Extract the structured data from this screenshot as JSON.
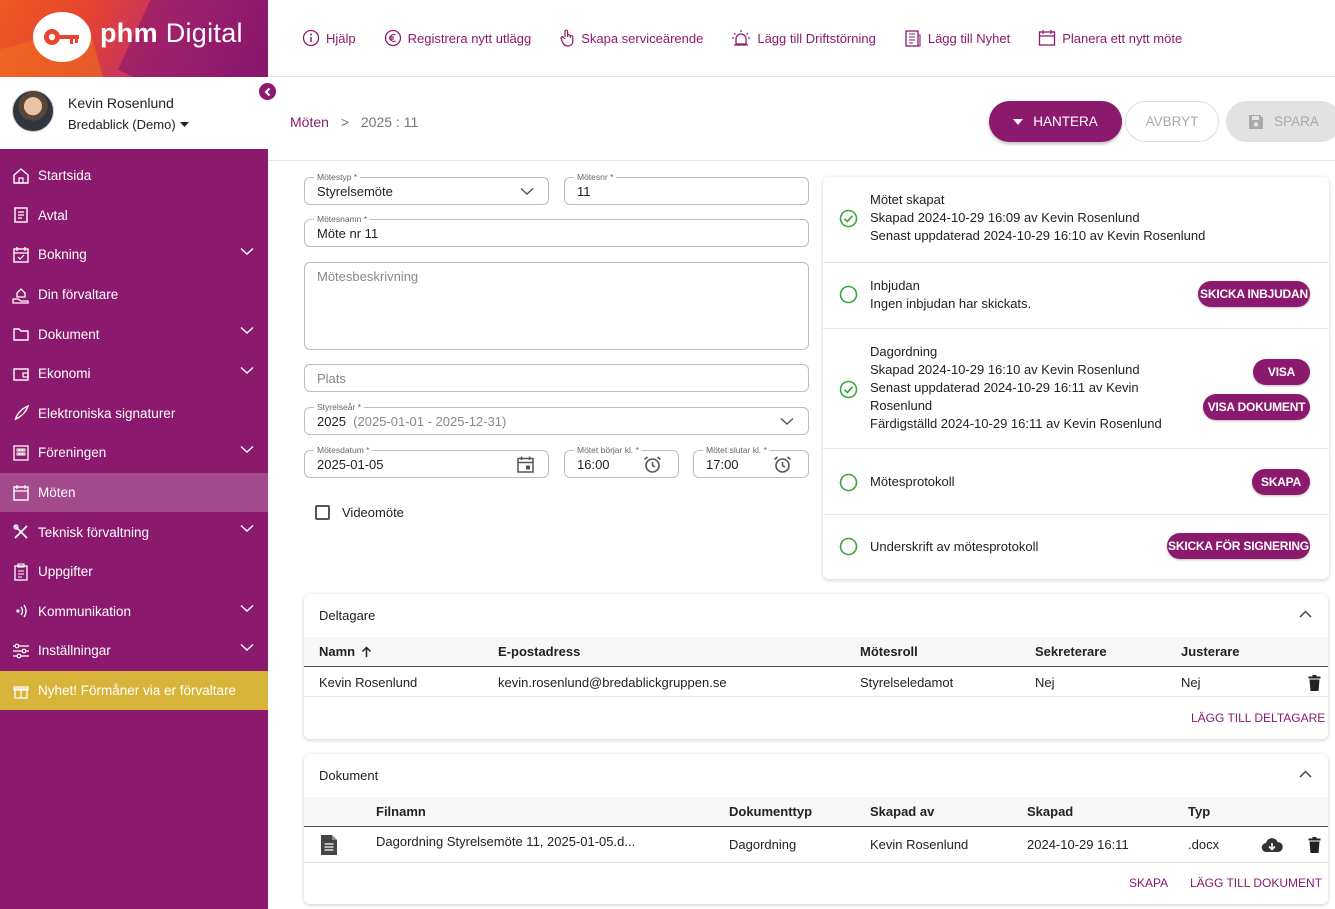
{
  "brand": {
    "name_bold": "phm",
    "name_rest": " Digital"
  },
  "user": {
    "name": "Kevin Rosenlund",
    "org": "Bredablick (Demo)"
  },
  "nav": [
    {
      "label": "Startsida",
      "icon": "home-icon",
      "chevron": false
    },
    {
      "label": "Avtal",
      "icon": "contract-icon",
      "chevron": false
    },
    {
      "label": "Bokning",
      "icon": "calendar-check-icon",
      "chevron": true
    },
    {
      "label": "Din förvaltare",
      "icon": "hand-house-icon",
      "chevron": false
    },
    {
      "label": "Dokument",
      "icon": "folder-icon",
      "chevron": true
    },
    {
      "label": "Ekonomi",
      "icon": "wallet-icon",
      "chevron": true
    },
    {
      "label": "Elektroniska signaturer",
      "icon": "feather-pen-icon",
      "chevron": false
    },
    {
      "label": "Föreningen",
      "icon": "building-icon",
      "chevron": true
    },
    {
      "label": "Möten",
      "icon": "calendar-icon",
      "chevron": false,
      "active": true
    },
    {
      "label": "Teknisk förvaltning",
      "icon": "tools-icon",
      "chevron": true
    },
    {
      "label": "Uppgifter",
      "icon": "checklist-icon",
      "chevron": false
    },
    {
      "label": "Kommunikation",
      "icon": "broadcast-icon",
      "chevron": true
    },
    {
      "label": "Inställningar",
      "icon": "sliders-icon",
      "chevron": true
    },
    {
      "label": "Nyhet! Förmåner via er förvaltare",
      "icon": "gift-icon",
      "chevron": false,
      "promo": true
    }
  ],
  "toolbar": {
    "help": "Hjälp",
    "expense": "Registrera nytt utlägg",
    "service": "Skapa serviceärende",
    "disruption": "Lägg till Driftstörning",
    "news": "Lägg till Nyhet",
    "meeting": "Planera ett nytt möte"
  },
  "breadcrumb": {
    "parent": "Möten",
    "separator": ">",
    "current": "2025 : 11"
  },
  "actions": {
    "manage": "HANTERA",
    "cancel": "AVBRYT",
    "save": "SPARA"
  },
  "form": {
    "meeting_type": {
      "label": "Mötestyp *",
      "value": "Styrelsemöte"
    },
    "meeting_no": {
      "label": "Mötesnr *",
      "value": "11"
    },
    "meeting_name": {
      "label": "Mötesnamn *",
      "value": "Möte nr 11"
    },
    "description": {
      "placeholder": "Mötesbeskrivning"
    },
    "location": {
      "placeholder": "Plats"
    },
    "board_year": {
      "label": "Styrelseår *",
      "value": "2025",
      "range": "(2025-01-01 - 2025-12-31)"
    },
    "date": {
      "label": "Mötesdatum *",
      "value": "2025-01-05"
    },
    "start": {
      "label": "Mötet börjar kl. *",
      "value": "16:00"
    },
    "end": {
      "label": "Mötet slutar kl. *",
      "value": "17:00"
    },
    "video": {
      "label": "Videomöte"
    }
  },
  "status": {
    "created": {
      "title": "Mötet skapat",
      "line1": "Skapad 2024-10-29 16:09 av Kevin Rosenlund",
      "line2": "Senast uppdaterad 2024-10-29 16:10 av Kevin Rosenlund"
    },
    "invite": {
      "title": "Inbjudan",
      "line1": "Ingen inbjudan har skickats.",
      "button": "SKICKA INBJUDAN"
    },
    "agenda": {
      "title": "Dagordning",
      "line1": "Skapad 2024-10-29 16:10 av Kevin Rosenlund",
      "line2a": "Senast uppdaterad 2024-10-29 16:11 av Kevin",
      "line2b": "Rosenlund",
      "line3": "Färdigställd 2024-10-29 16:11 av Kevin Rosenlund",
      "button_view": "VISA",
      "button_doc": "VISA DOKUMENT"
    },
    "minutes": {
      "title": "Mötesprotokoll",
      "button": "SKAPA"
    },
    "signature": {
      "title": "Underskrift av mötesprotokoll",
      "button": "SKICKA FÖR SIGNERING"
    }
  },
  "participants": {
    "title": "Deltagare",
    "columns": {
      "name": "Namn",
      "email": "E-postadress",
      "role": "Mötesroll",
      "secretary": "Sekreterare",
      "adjuster": "Justerare"
    },
    "rows": [
      {
        "name": "Kevin Rosenlund",
        "email": "kevin.rosenlund@bredablickgruppen.se",
        "role": "Styrelseledamot",
        "secretary": "Nej",
        "adjuster": "Nej"
      }
    ],
    "add_label": "LÄGG TILL DELTAGARE"
  },
  "documents": {
    "title": "Dokument",
    "columns": {
      "filename": "Filnamn",
      "doctype": "Dokumenttyp",
      "created_by": "Skapad av",
      "created": "Skapad",
      "type": "Typ"
    },
    "rows": [
      {
        "filename": "Dagordning Styrelsemöte 11, 2025-01-05.d...",
        "doctype": "Dagordning",
        "created_by": "Kevin Rosenlund",
        "created": "2024-10-29 16:11",
        "type": ".docx"
      }
    ],
    "create_label": "SKAPA",
    "add_label": "LÄGG TILL DOKUMENT"
  },
  "colors": {
    "brand": "#8b1a6e",
    "active_nav": "#a24a8c",
    "promo": "#d9b43a",
    "success": "#3aa544"
  }
}
